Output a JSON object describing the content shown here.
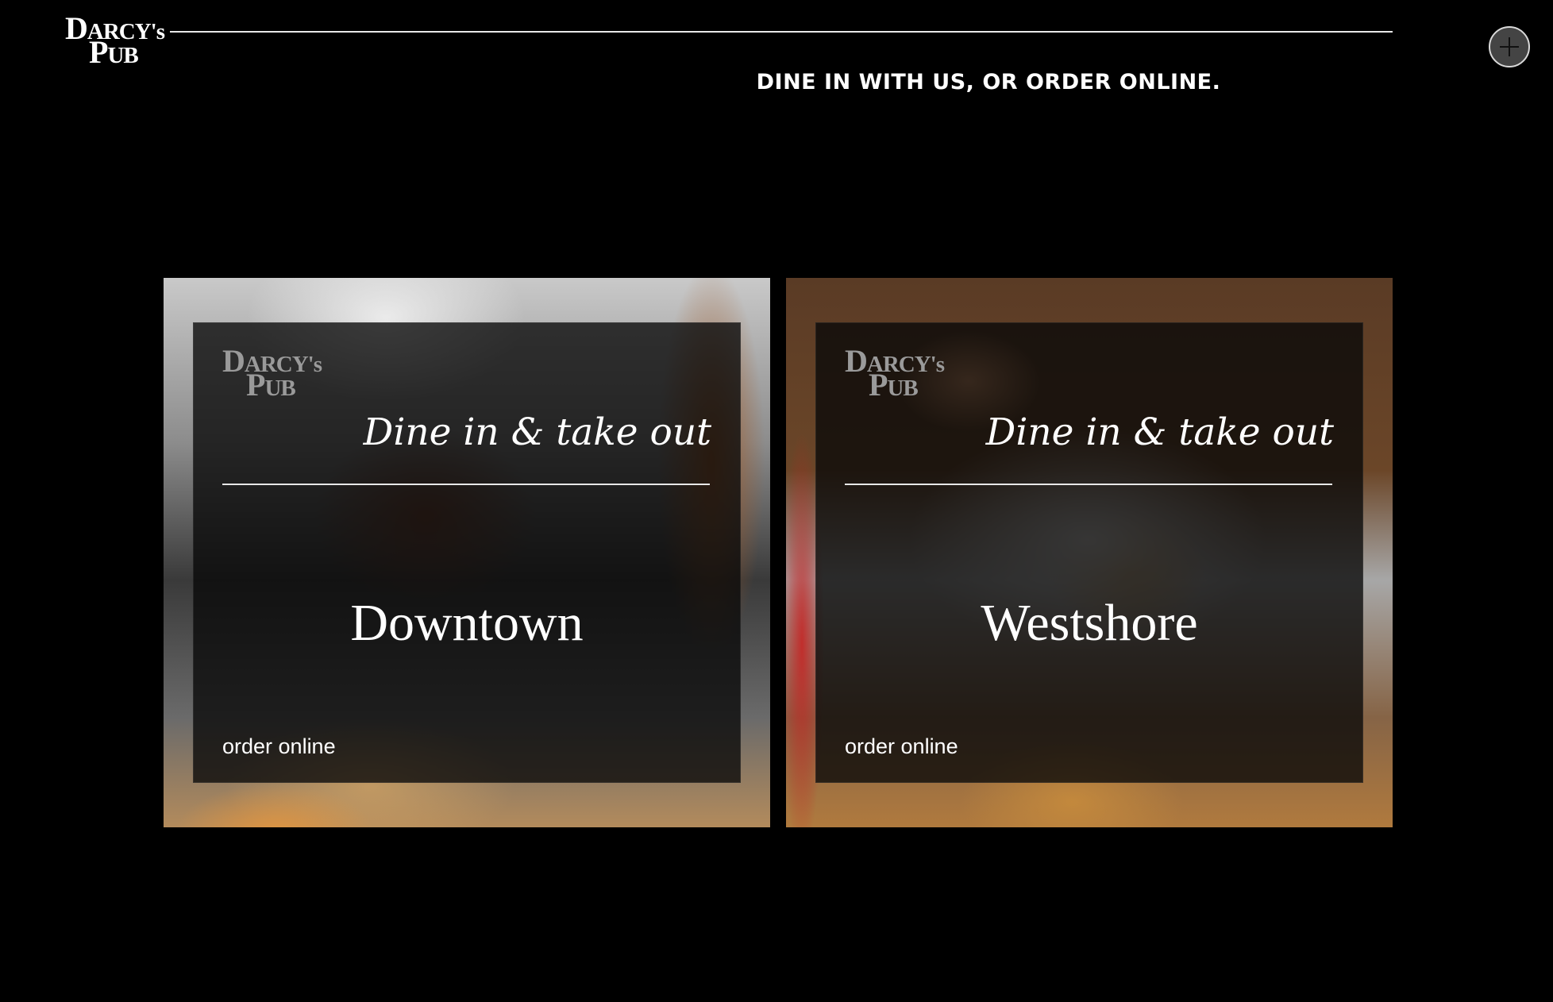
{
  "header": {
    "logo": {
      "line1": {
        "d": "D",
        "rest": "ARCY",
        "apos": "'s"
      },
      "line2": {
        "p": "P",
        "rest": "UB"
      }
    },
    "tagline": "DINE IN WITH US, OR ORDER ONLINE.",
    "menu_icon": "plus-icon"
  },
  "locations": [
    {
      "logo": {
        "line1": {
          "d": "D",
          "rest": "ARCY",
          "apos": "'s"
        },
        "line2": {
          "p": "P",
          "rest": "UB"
        }
      },
      "subtitle": "Dine in & take out",
      "name": "Downtown",
      "order_label": "order online"
    },
    {
      "logo": {
        "line1": {
          "d": "D",
          "rest": "ARCY",
          "apos": "'s"
        },
        "line2": {
          "p": "P",
          "rest": "UB"
        }
      },
      "subtitle": "Dine in & take out",
      "name": "Westshore",
      "order_label": "order online"
    }
  ],
  "colors": {
    "background": "#000000",
    "text": "#ffffff",
    "panel_logo": "#9a9a9a"
  }
}
